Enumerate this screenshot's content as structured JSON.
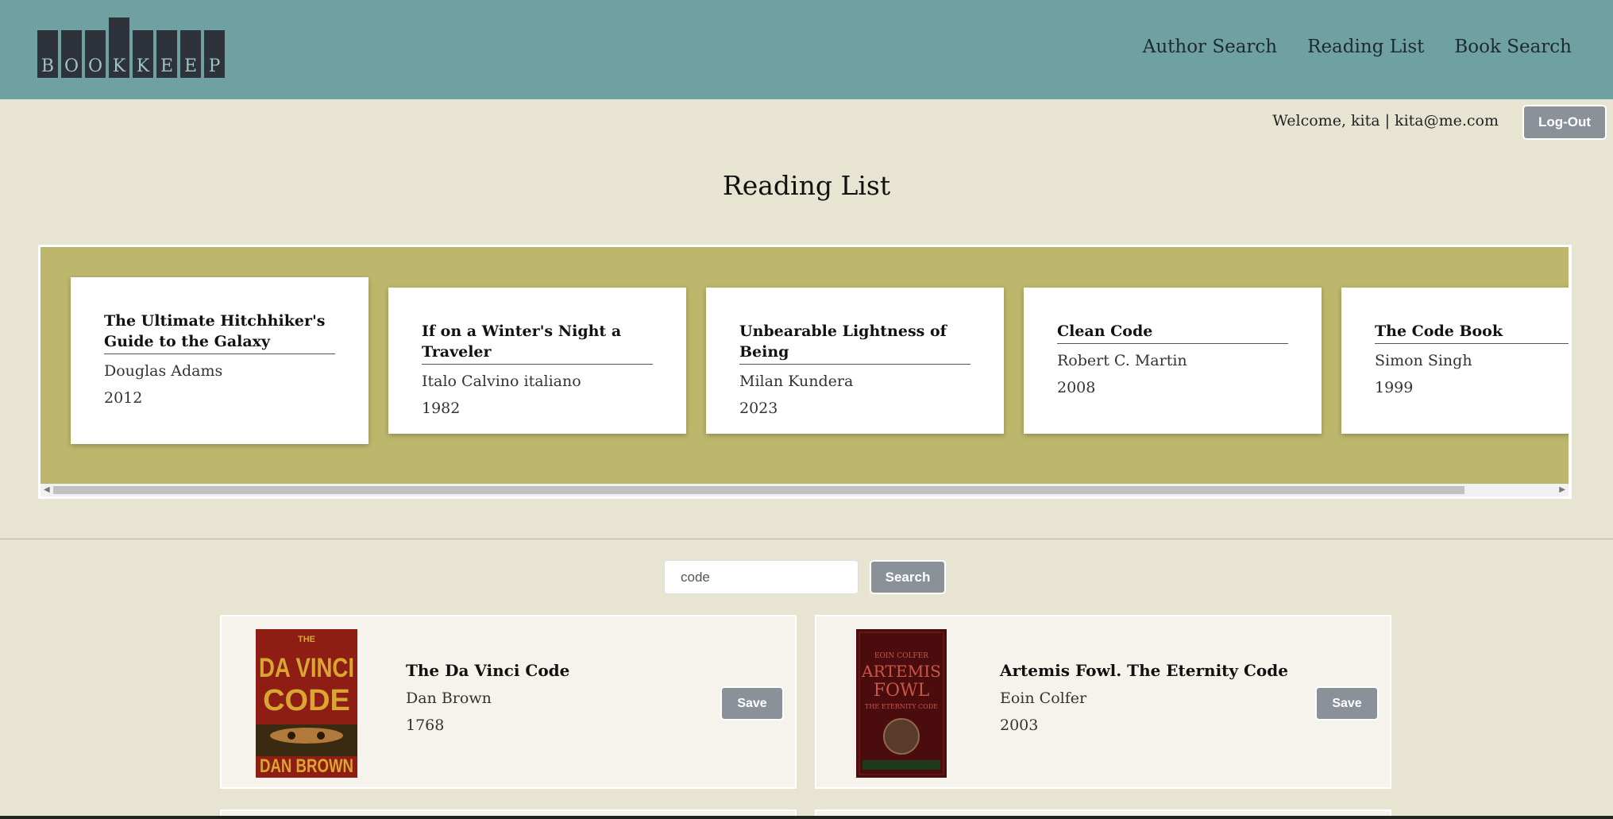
{
  "brand": {
    "letters": [
      "B",
      "O",
      "O",
      "K",
      "K",
      "E",
      "E",
      "P"
    ]
  },
  "nav": [
    "Author Search",
    "Reading List",
    "Book Search"
  ],
  "user": {
    "welcome": "Welcome, kita | kita@me.com",
    "logout_label": "Log-Out"
  },
  "page_title": "Reading List",
  "reading_list": [
    {
      "title": "The Ultimate Hitchhiker's Guide to the Galaxy",
      "author": "Douglas Adams",
      "year": "2012"
    },
    {
      "title": "If on a Winter's Night a Traveler",
      "author": "Italo Calvino italiano",
      "year": "1982"
    },
    {
      "title": "Unbearable Lightness of Being",
      "author": "Milan Kundera",
      "year": "2023"
    },
    {
      "title": "Clean Code",
      "author": "Robert C. Martin",
      "year": "2008"
    },
    {
      "title": "The Code Book",
      "author": "Simon Singh",
      "year": "1999"
    }
  ],
  "search": {
    "value": "code",
    "button_label": "Search"
  },
  "results": [
    {
      "title": "The Da Vinci Code",
      "author": "Dan Brown",
      "year": "1768",
      "save_label": "Save",
      "cover": {
        "top": "THE",
        "line1": "DA VINCI",
        "line2": "CODE",
        "author": "DAN BROWN"
      }
    },
    {
      "title": "Artemis Fowl. The Eternity Code",
      "author": "Eoin Colfer",
      "year": "2003",
      "save_label": "Save",
      "cover": {
        "top": "EOIN COLFER",
        "line1": "ARTEMIS",
        "line2": "FOWL",
        "sub": "THE ETERNITY CODE"
      }
    }
  ],
  "colors": {
    "header": "#6fa1a3",
    "page_bg": "#e8e4d2",
    "carousel_bg": "#bdb76d",
    "button": "#8a9199"
  }
}
